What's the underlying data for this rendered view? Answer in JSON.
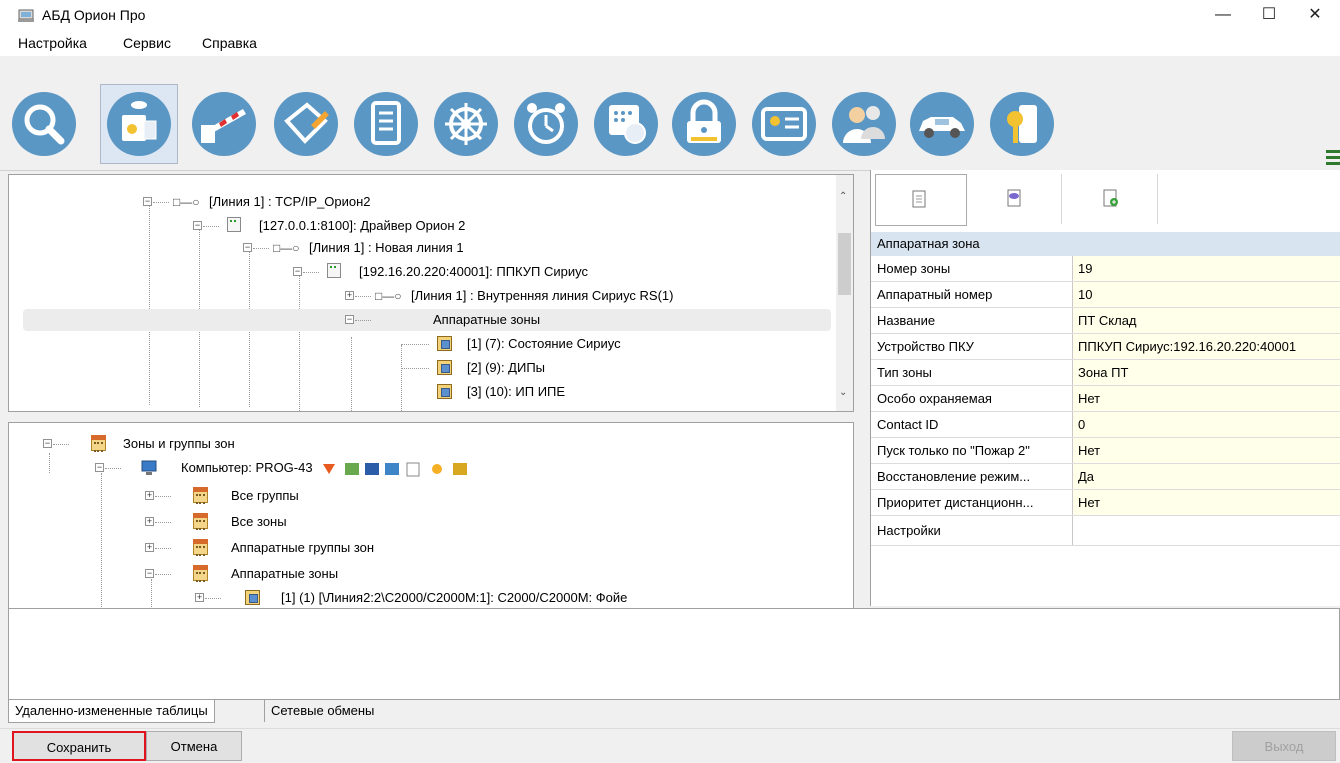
{
  "window": {
    "title": "АБД Орион Про",
    "minimize": "—",
    "maximize": "☐",
    "close": "✕"
  },
  "menu": [
    "Настройка",
    "Сервис",
    "Справка"
  ],
  "toolbar": {
    "buttons": [
      "search-icon",
      "devices-icon",
      "barrier-icon",
      "plan-edit-icon",
      "document-icon",
      "wheel-icon",
      "alarm-clock-icon",
      "schedule-icon",
      "lock-icon",
      "card-icon",
      "users-icon",
      "car-icon",
      "key-icon"
    ],
    "selected_index": 1,
    "accent": "#5b97c4"
  },
  "device_tree": {
    "rows": [
      {
        "text": "[Линия 1] : TCP/IP_Орион2"
      },
      {
        "text": "[127.0.0.1:8100]: Драйвер Орион 2"
      },
      {
        "text": "[Линия 1] : Новая линия 1"
      },
      {
        "text": "[192.16.20.220:40001]: ППКУП Сириус"
      },
      {
        "text": "[Линия 1] : Внутренняя линия Сириус RS(1)"
      },
      {
        "text": "Аппаратные зоны"
      },
      {
        "text": "[1] (7): Состояние Сириус"
      },
      {
        "text": "[2] (9): ДИПы"
      },
      {
        "text": "[3] (10): ИП ИПЕ"
      }
    ]
  },
  "zone_tree": {
    "rows": [
      {
        "text": "Зоны и группы зон"
      },
      {
        "text": "Компьютер: PROG-43"
      },
      {
        "text": "Все группы"
      },
      {
        "text": "Все зоны"
      },
      {
        "text": "Аппаратные группы зон"
      },
      {
        "text": "Аппаратные зоны"
      },
      {
        "text": "[1] (1) [\\Линия2:2\\С2000/С2000М:1]: С2000/С2000М: Фойе"
      }
    ]
  },
  "properties": {
    "tabs": [
      "properties-tab-icon",
      "comment-tab-icon",
      "add-tab-icon"
    ],
    "section": "Аппаратная зона",
    "rows": [
      {
        "key": "Номер зоны",
        "value": "19"
      },
      {
        "key": "Аппаратный номер",
        "value": "10"
      },
      {
        "key": "Название",
        "value": "ПТ Склад"
      },
      {
        "key": "Устройство ПКУ",
        "value": "ППКУП Сириус:192.16.20.220:40001"
      },
      {
        "key": "Тип зоны",
        "value": "Зона ПТ"
      },
      {
        "key": "Особо охраняемая",
        "value": "Нет"
      },
      {
        "key": "Contact ID",
        "value": "0"
      },
      {
        "key": "Пуск только по \"Пожар 2\"",
        "value": "Нет"
      },
      {
        "key": "Восстановление режим...",
        "value": "Да"
      },
      {
        "key": "Приоритет дистанционн...",
        "value": "Нет"
      },
      {
        "key": "Настройки",
        "value": ""
      }
    ]
  },
  "bottom_tabs": [
    "Удаленно-измененные таблицы",
    "Сетевые обмены"
  ],
  "footer": {
    "save": "Сохранить",
    "cancel": "Отмена",
    "exit": "Выход"
  }
}
